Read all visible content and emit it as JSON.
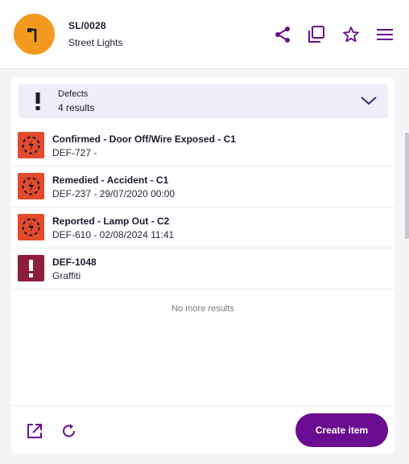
{
  "header": {
    "title": "SL/0028",
    "subtitle": "Street Lights",
    "avatar_icon": "street-light-icon",
    "avatar_color": "#f39a1e",
    "actions": [
      "share-icon",
      "duplicate-icon",
      "star-icon",
      "menu-icon"
    ]
  },
  "defects": {
    "title": "Defects",
    "count_label": "4 results",
    "items": [
      {
        "title": "Confirmed - Door Off/Wire Exposed - C1",
        "subtitle": "DEF-727 -",
        "icon": "hazard-icon",
        "color": "#e44a2c"
      },
      {
        "title": "Remedied - Accident - C1",
        "subtitle": "DEF-237 -  29/07/2020 00:00",
        "icon": "hazard-icon",
        "color": "#e44a2c"
      },
      {
        "title": "Reported - Lamp Out - C2",
        "subtitle": "DEF-610 -  02/08/2024 11:41",
        "icon": "hazard-icon",
        "color": "#e44a2c"
      },
      {
        "title": "DEF-1048",
        "subtitle": "Graffiti",
        "icon": "exclamation-icon",
        "color": "#8e1d3f"
      }
    ],
    "end_label": "No more results"
  },
  "footer": {
    "open_icon": "open-external-icon",
    "refresh_icon": "refresh-icon",
    "create_label": "Create item"
  },
  "colors": {
    "accent": "#6a0c8f",
    "header_bg": "#efedf8"
  }
}
